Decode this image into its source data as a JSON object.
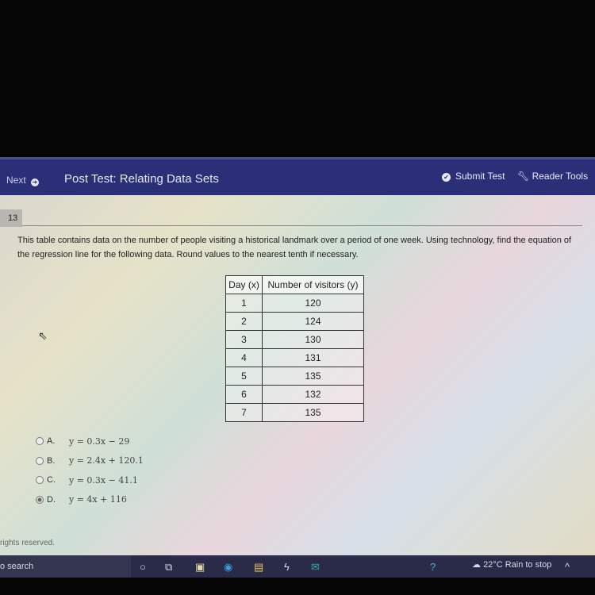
{
  "header": {
    "next_label": "Next",
    "title": "Post Test: Relating Data Sets",
    "submit_label": "Submit Test",
    "reader_tools_label": "Reader Tools"
  },
  "question": {
    "number": "13",
    "prompt": "This table contains data on the number of people visiting a historical landmark over a period of one week. Using technology, find the equation of the regression line for the following data. Round values to the nearest tenth if necessary.",
    "table": {
      "headers": [
        "Day (x)",
        "Number of visitors (y)"
      ],
      "rows": [
        [
          "1",
          "120"
        ],
        [
          "2",
          "124"
        ],
        [
          "3",
          "130"
        ],
        [
          "4",
          "131"
        ],
        [
          "5",
          "135"
        ],
        [
          "6",
          "132"
        ],
        [
          "7",
          "135"
        ]
      ]
    },
    "options": [
      {
        "letter": "A.",
        "equation": "y = 0.3x − 29",
        "selected": false
      },
      {
        "letter": "B.",
        "equation": "y = 2.4x + 120.1",
        "selected": false
      },
      {
        "letter": "C.",
        "equation": "y = 0.3x − 41.1",
        "selected": false
      },
      {
        "letter": "D.",
        "equation": "y = 4x + 116",
        "selected": true
      }
    ]
  },
  "footer": {
    "copyright": "rights reserved."
  },
  "taskbar": {
    "search": "o search",
    "weather": "22°C  Rain to stop"
  }
}
